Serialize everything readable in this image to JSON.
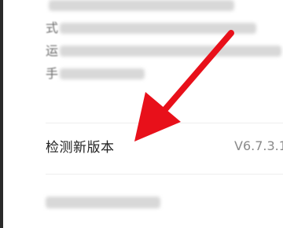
{
  "settings": {
    "check_update_label": "检测新版本",
    "version": "V6.7.3.1"
  },
  "colors": {
    "arrow": "#e8101a",
    "label_text": "#222222",
    "value_text": "#8a8a8a",
    "divider": "#eeeeee"
  },
  "icons": {
    "annotation": "red-arrow-icon"
  }
}
